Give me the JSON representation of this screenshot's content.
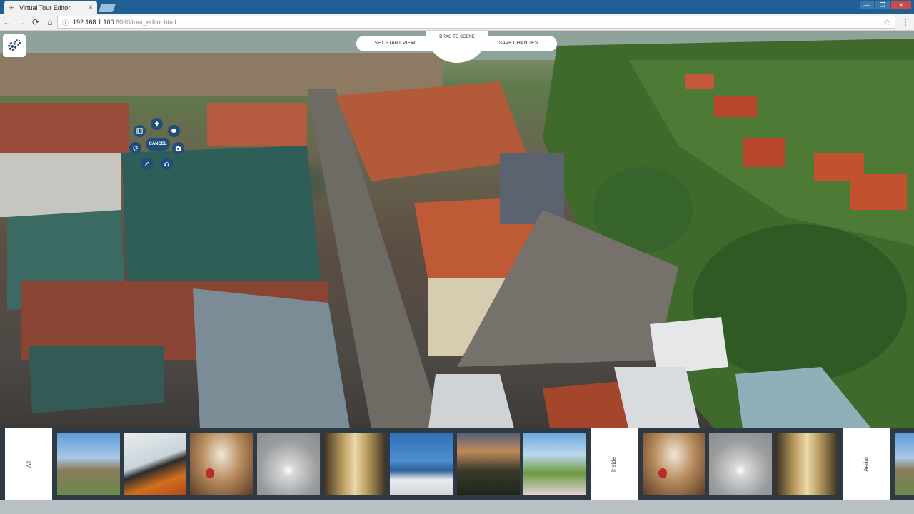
{
  "browser": {
    "tab_title": "Virtual Tour Editor",
    "tab_close": "×",
    "url_host": "192.168.1.100",
    "url_rest": ":8090/tour_editor.html",
    "nav_back": "←",
    "nav_forward": "→",
    "nav_reload": "⟳",
    "nav_home": "⌂",
    "star": "☆",
    "menu": "⋮",
    "window_controls": [
      "—",
      "❐",
      "✕"
    ]
  },
  "toolbar": {
    "set_start_view": "SET START VIEW",
    "drag_to_scene": "DRAG TO SCENE",
    "save_changes": "SAVE CHANGES"
  },
  "radial_menu": {
    "cancel_label": "CANCEL",
    "items": [
      "film-icon",
      "up-arrow-icon",
      "chat-icon",
      "settings-icon",
      "camera-icon",
      "edit-icon",
      "audio-icon"
    ]
  },
  "filmstrip": {
    "groups": [
      "All",
      "Inside",
      "Aerial"
    ],
    "thumbnails": [
      "aerial-town",
      "kayak",
      "brick-cellar",
      "bright-light",
      "hall",
      "sailboat",
      "sunset",
      "blossom-garden",
      "brick-cellar",
      "bright-light",
      "hall",
      "edge-partial"
    ]
  },
  "colors": {
    "tab_bar": "#1f5f93",
    "radial_menu": "#1f4e79",
    "filmstrip_bg": "#2d3a44",
    "bottom_strip": "#b9c0c3"
  }
}
